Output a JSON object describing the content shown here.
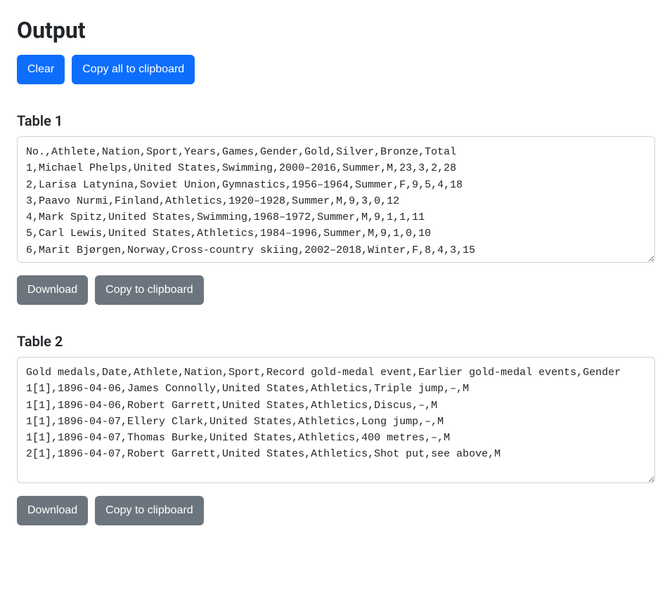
{
  "header": {
    "title": "Output",
    "clear_label": "Clear",
    "copy_all_label": "Copy all to clipboard"
  },
  "tables": [
    {
      "title": "Table 1",
      "download_label": "Download",
      "copy_label": "Copy to clipboard",
      "csv": "No.,Athlete,Nation,Sport,Years,Games,Gender,Gold,Silver,Bronze,Total\n1,Michael Phelps,United States,Swimming,2000–2016,Summer,M,23,3,2,28\n2,Larisa Latynina,Soviet Union,Gymnastics,1956–1964,Summer,F,9,5,4,18\n3,Paavo Nurmi,Finland,Athletics,1920–1928,Summer,M,9,3,0,12\n4,Mark Spitz,United States,Swimming,1968–1972,Summer,M,9,1,1,11\n5,Carl Lewis,United States,Athletics,1984–1996,Summer,M,9,1,0,10\n6,Marit Bjørgen,Norway,Cross-country skiing,2002–2018,Winter,F,8,4,3,15"
    },
    {
      "title": "Table 2",
      "download_label": "Download",
      "copy_label": "Copy to clipboard",
      "csv": "Gold medals,Date,Athlete,Nation,Sport,Record gold-medal event,Earlier gold-medal events,Gender\n1[1],1896-04-06,James Connolly,United States,Athletics,Triple jump,–,M\n1[1],1896-04-06,Robert Garrett,United States,Athletics,Discus,–,M\n1[1],1896-04-07,Ellery Clark,United States,Athletics,Long jump,–,M\n1[1],1896-04-07,Thomas Burke,United States,Athletics,400 metres,–,M\n2[1],1896-04-07,Robert Garrett,United States,Athletics,Shot put,see above,M"
    }
  ]
}
